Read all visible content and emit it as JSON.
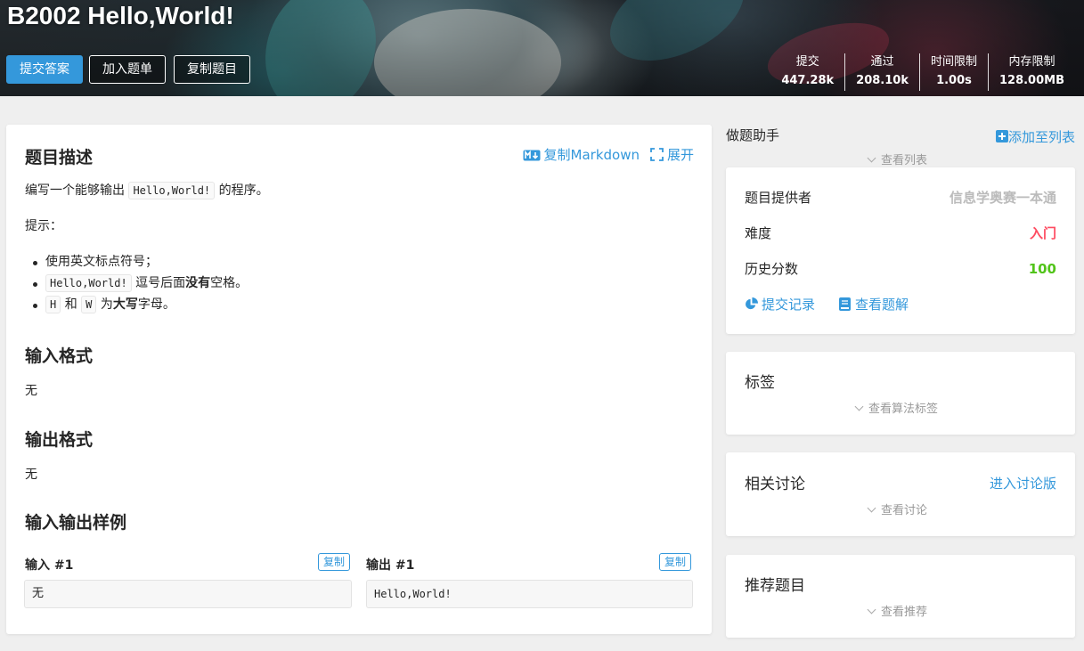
{
  "header": {
    "title": "B2002 Hello,World!",
    "buttons": {
      "submit": "提交答案",
      "add_to_list": "加入题单",
      "copy_problem": "复制题目"
    },
    "stats": [
      {
        "label": "提交",
        "value": "447.28k"
      },
      {
        "label": "通过",
        "value": "208.10k"
      },
      {
        "label": "时间限制",
        "value": "1.00s"
      },
      {
        "label": "内存限制",
        "value": "128.00MB"
      }
    ]
  },
  "problem": {
    "description_title": "题目描述",
    "copy_markdown": "复制Markdown",
    "expand": "展开",
    "desc": {
      "before": "编写一个能够输出",
      "code": "Hello,World!",
      "after": "的程序。"
    },
    "hint_label": "提示：",
    "bullet1": "使用英文标点符号；",
    "bullet2": {
      "code": "Hello,World!",
      "text1": "逗号后面",
      "bold": "没有",
      "text2": "空格。"
    },
    "bullet3": {
      "code1": "H",
      "and": "和",
      "code2": "W",
      "text1": "为",
      "bold": "大写",
      "text2": "字母。"
    },
    "input_format_title": "输入格式",
    "input_format": "无",
    "output_format_title": "输出格式",
    "output_format": "无",
    "samples_title": "输入输出样例",
    "sample_input_label": "输入 #1",
    "sample_output_label": "输出 #1",
    "copy": "复制",
    "sample_input": "无",
    "sample_output": "Hello,World!"
  },
  "sidebar": {
    "helper_title": "做题助手",
    "add_to_list": "添加至列表",
    "view_list": "查看列表",
    "info": {
      "provider_label": "题目提供者",
      "provider_value": "信息学奥赛一本通",
      "difficulty_label": "难度",
      "difficulty_value": "入门",
      "history_label": "历史分数",
      "history_value": "100",
      "records": "提交记录",
      "solutions": "查看题解"
    },
    "tags": {
      "title": "标签",
      "expand": "查看算法标签"
    },
    "discuss": {
      "title": "相关讨论",
      "link": "进入讨论版",
      "expand": "查看讨论"
    },
    "recommend": {
      "title": "推荐题目",
      "expand": "查看推荐"
    }
  },
  "colors": {
    "accent": "#3498db",
    "difficulty": "#fe4c61",
    "score": "#52c41a",
    "muted": "#bbbbbb"
  }
}
